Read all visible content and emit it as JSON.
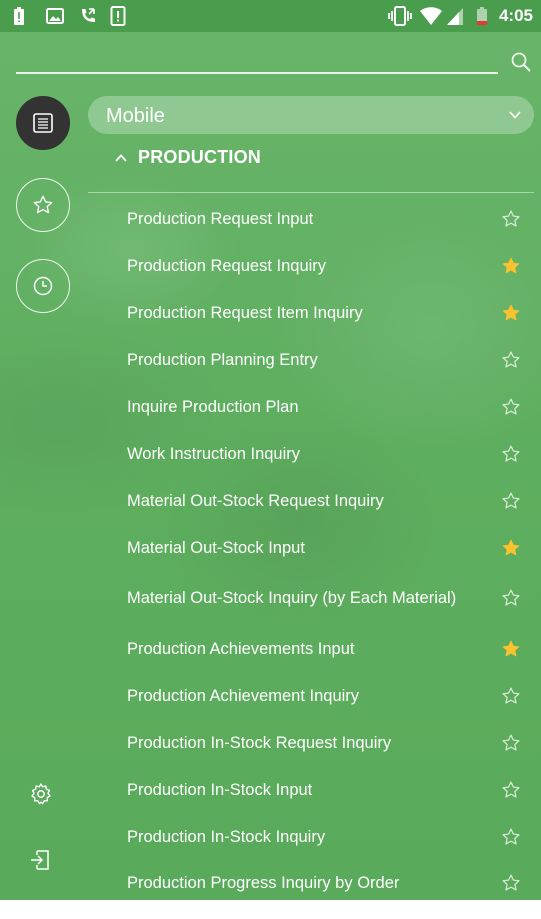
{
  "status_bar": {
    "time": "4:05"
  },
  "search": {
    "icon": "search-icon"
  },
  "rail": {
    "items": [
      {
        "icon": "list-icon",
        "active": true
      },
      {
        "icon": "star-outline-icon",
        "active": false
      },
      {
        "icon": "clock-icon",
        "active": false
      }
    ],
    "bottom": [
      {
        "icon": "gear-icon"
      },
      {
        "icon": "logout-icon"
      }
    ]
  },
  "dropdown": {
    "selected": "Mobile"
  },
  "section": {
    "title": "PRODUCTION"
  },
  "menu": {
    "items": [
      {
        "label": "Production Request Input",
        "favorite": false
      },
      {
        "label": "Production Request Inquiry",
        "favorite": true
      },
      {
        "label": "Production Request Item Inquiry",
        "favorite": true
      },
      {
        "label": "Production Planning Entry",
        "favorite": false
      },
      {
        "label": "Inquire Production Plan",
        "favorite": false
      },
      {
        "label": "Work Instruction Inquiry",
        "favorite": false
      },
      {
        "label": "Material Out-Stock Request Inquiry",
        "favorite": false
      },
      {
        "label": "Material Out-Stock Input",
        "favorite": true
      },
      {
        "label": "Material Out-Stock Inquiry (by Each Material)",
        "favorite": false
      },
      {
        "label": "Production Achievements Input",
        "favorite": true
      },
      {
        "label": "Production Achievement Inquiry",
        "favorite": false
      },
      {
        "label": "Production In-Stock Request Inquiry",
        "favorite": false
      },
      {
        "label": "Production In-Stock Input",
        "favorite": false
      },
      {
        "label": "Production In-Stock Inquiry",
        "favorite": false
      },
      {
        "label": "Production Progress Inquiry by Order",
        "favorite": false
      }
    ]
  },
  "colors": {
    "background": "#5eae5f",
    "status_bar": "#4a9d4c",
    "active_rail": "#333333",
    "favorite_star": "#f9c22e"
  }
}
